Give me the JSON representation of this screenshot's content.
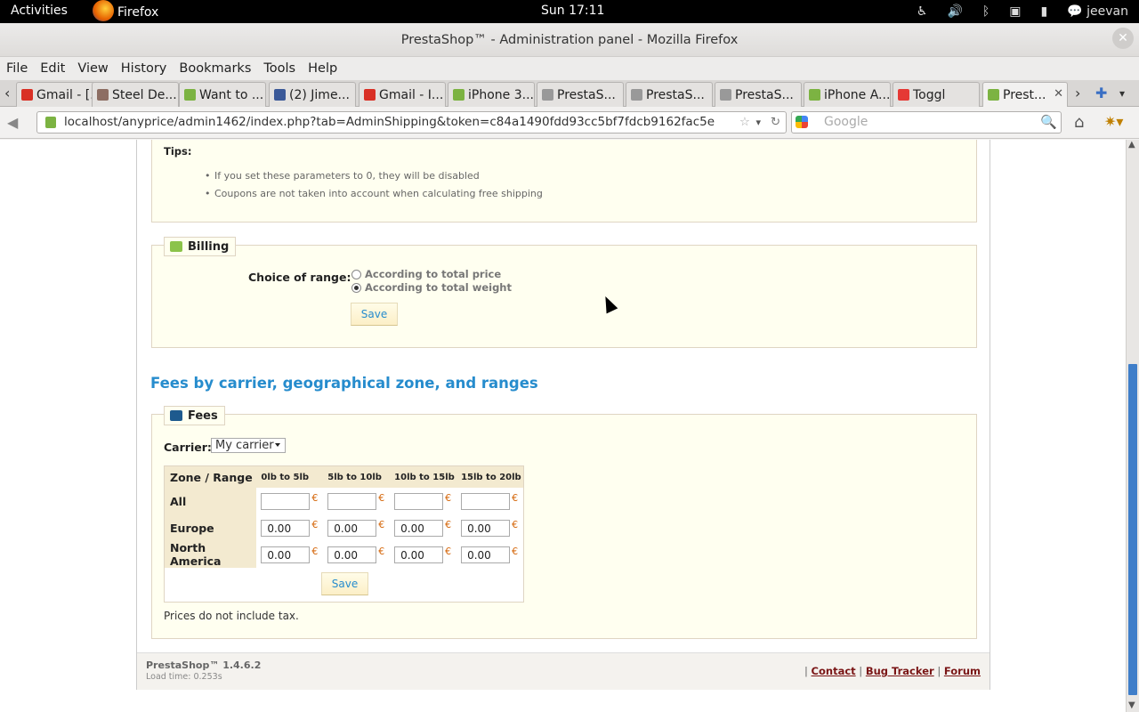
{
  "system": {
    "activities": "Activities",
    "app": "Firefox",
    "clock": "Sun 17:11",
    "user": "jeevan"
  },
  "window": {
    "title": "PrestaShop™ - Administration panel - Mozilla Firefox"
  },
  "menu": [
    "File",
    "Edit",
    "View",
    "History",
    "Bookmarks",
    "Tools",
    "Help"
  ],
  "tabs": [
    {
      "label": "Gmail - [...",
      "icon_color": "#d93025"
    },
    {
      "label": "Steel De...",
      "icon_color": "#8d6e63"
    },
    {
      "label": "Want to ...",
      "icon_color": "#7cb342"
    },
    {
      "label": "(2) Jime...",
      "icon_color": "#3b5998"
    },
    {
      "label": "Gmail - I...",
      "icon_color": "#d93025"
    },
    {
      "label": "iPhone 3...",
      "icon_color": "#7cb342"
    },
    {
      "label": "PrestaS...",
      "icon_color": "#999999"
    },
    {
      "label": "PrestaS...",
      "icon_color": "#999999"
    },
    {
      "label": "PrestaS...",
      "icon_color": "#999999"
    },
    {
      "label": "iPhone A...",
      "icon_color": "#7cb342"
    },
    {
      "label": "Toggl",
      "icon_color": "#e53935"
    },
    {
      "label": "Prest...",
      "icon_color": "#7cb342",
      "active": true
    }
  ],
  "url": "localhost/anyprice/admin1462/index.php?tab=AdminShipping&token=c84a1490fdd93cc5bf7fdcb9162fac5e",
  "search_placeholder": "Google",
  "tips": {
    "title": "Tips:",
    "items": [
      "If you set these parameters to 0, they will be disabled",
      "Coupons are not taken into account when calculating free shipping"
    ]
  },
  "billing": {
    "legend": "Billing",
    "label": "Choice of range:",
    "options": [
      "According to total price",
      "According to total weight"
    ],
    "selected": 1,
    "save": "Save"
  },
  "fees_heading": "Fees by carrier, geographical zone, and ranges",
  "fees": {
    "legend": "Fees",
    "carrier_label": "Carrier:",
    "carrier_value": "My carrier",
    "columns": [
      "Zone / Range",
      "0lb to 5lb",
      "5lb to 10lb",
      "10lb to 15lb",
      "15lb to 20lb"
    ],
    "rows": [
      {
        "zone": "All",
        "values": [
          "",
          "",
          "",
          ""
        ]
      },
      {
        "zone": "Europe",
        "values": [
          "0.00",
          "0.00",
          "0.00",
          "0.00"
        ]
      },
      {
        "zone": "North America",
        "values": [
          "0.00",
          "0.00",
          "0.00",
          "0.00"
        ]
      }
    ],
    "currency": "€",
    "save": "Save",
    "note": "Prices do not include tax."
  },
  "footer": {
    "version": "PrestaShop™ 1.4.6.2",
    "load": "Load time: 0.253s",
    "links": [
      "Contact",
      "Bug Tracker",
      "Forum"
    ]
  },
  "colors": {
    "accent": "#268ccd",
    "panel_bg": "#fffff0",
    "header_bg": "#f3ead0"
  }
}
